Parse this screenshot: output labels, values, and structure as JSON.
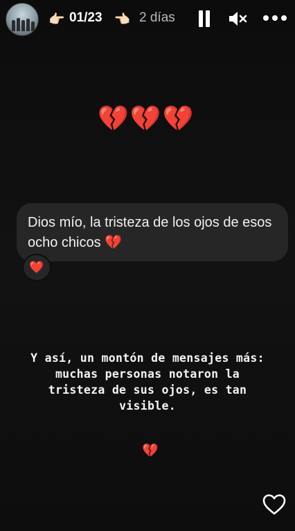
{
  "header": {
    "counter": "01/23",
    "time_ago": "2 días",
    "hand_left_emoji": "👉🏻",
    "hand_right_emoji": "👈🏻",
    "icons": [
      "avatar",
      "pause-icon",
      "mute-icon",
      "more-icon"
    ]
  },
  "story": {
    "emoji_row": "💔💔💔",
    "message": {
      "text": "Dios mío, la tristeza de los ojos de esos ocho chicos 💔",
      "reaction": "❤️"
    },
    "caption": "Y así, un montón de mensajes más: muchas personas notaron la tristeza de sus ojos, es tan visible.",
    "small_emoji": "💔"
  },
  "footer": {
    "icons": [
      "heart-outline-icon"
    ]
  }
}
